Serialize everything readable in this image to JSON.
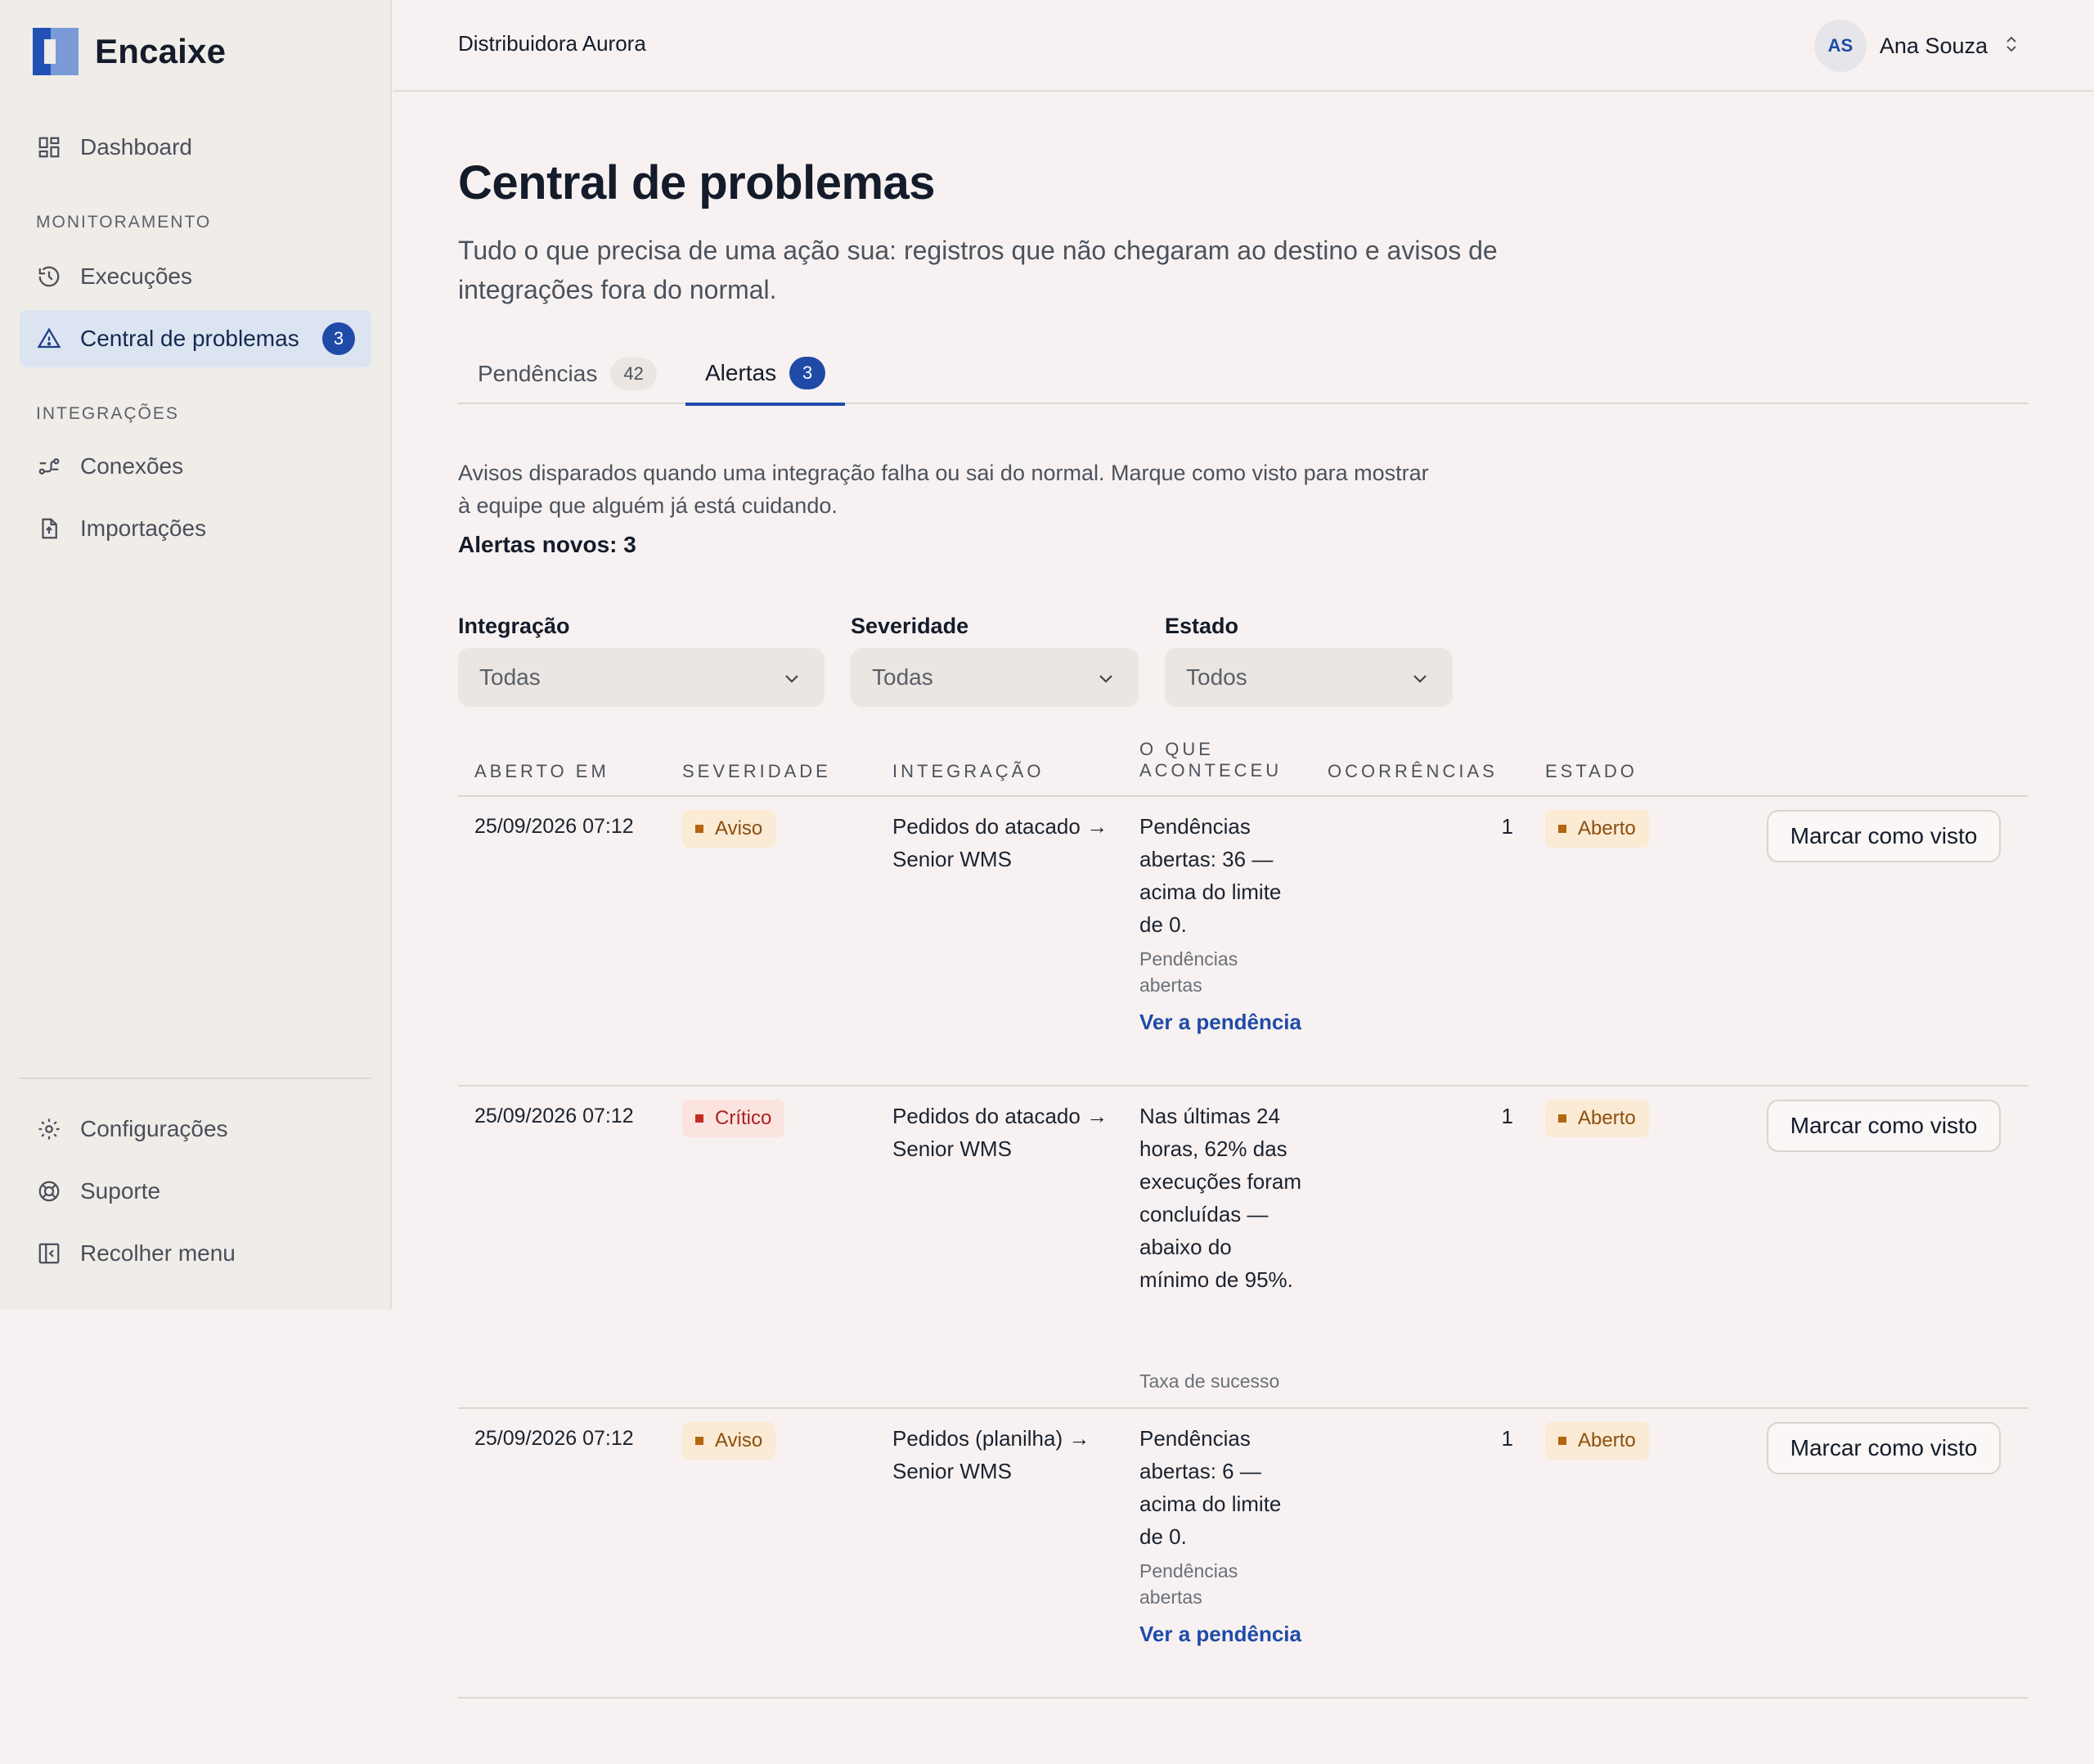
{
  "brand": {
    "name": "Encaixe"
  },
  "sidebar": {
    "items": [
      {
        "label": "Dashboard",
        "icon": "dashboard-icon"
      },
      {
        "label": "Execuções",
        "icon": "history-icon"
      },
      {
        "label": "Central de problemas",
        "icon": "warning-icon",
        "badge": "3",
        "active": true
      },
      {
        "label": "Conexões",
        "icon": "connections-icon"
      },
      {
        "label": "Importações",
        "icon": "file-import-icon"
      }
    ],
    "sections": {
      "monitoring": "MONITORAMENTO",
      "integrations": "INTEGRAÇÕES"
    },
    "footer": [
      {
        "label": "Configurações",
        "icon": "gear-icon"
      },
      {
        "label": "Suporte",
        "icon": "lifebuoy-icon"
      },
      {
        "label": "Recolher menu",
        "icon": "collapse-sidebar-icon"
      }
    ]
  },
  "topbar": {
    "org": "Distribuidora Aurora",
    "user": {
      "initials": "AS",
      "name": "Ana Souza"
    }
  },
  "page": {
    "title": "Central de problemas",
    "subtitle": "Tudo o que precisa de uma ação sua: registros que não chegaram ao destino e avisos de integrações fora do normal."
  },
  "tabs": [
    {
      "label": "Pendências",
      "count": "42"
    },
    {
      "label": "Alertas",
      "count": "3",
      "active": true
    }
  ],
  "alerts": {
    "intro": "Avisos disparados quando uma integração falha ou sai do normal. Marque como visto para mostrar à equipe que alguém já está cuidando.",
    "count_text": "Alertas novos: 3",
    "filters": [
      {
        "label": "Integração",
        "value": "Todas"
      },
      {
        "label": "Severidade",
        "value": "Todas"
      },
      {
        "label": "Estado",
        "value": "Todos"
      }
    ],
    "columns": [
      "ABERTO EM",
      "SEVERIDADE",
      "INTEGRAÇÃO",
      "O QUE ACONTECEU",
      "OCORRÊNCIAS",
      "ESTADO"
    ],
    "rows": [
      {
        "opened": "25/09/2026 07:12",
        "severity": "Aviso",
        "integration": "Pedidos do atacado → Senior WMS",
        "what": "Pendências abertas: 36 — acima do limite de 0.",
        "metric": "Pendências abertas",
        "link": "Ver a pendência",
        "occurrences": "1",
        "state": "Aberto",
        "action": "Marcar como visto"
      },
      {
        "opened": "25/09/2026 07:12",
        "severity": "Crítico",
        "integration": "Pedidos do atacado → Senior WMS",
        "what": "Nas últimas 24 horas, 62% das execuções foram concluídas — abaixo do mínimo de 95%.",
        "metric": "Taxa de sucesso",
        "occurrences": "1",
        "state": "Aberto",
        "action": "Marcar como visto"
      },
      {
        "opened": "25/09/2026 07:12",
        "severity": "Aviso",
        "integration": "Pedidos (planilha) → Senior WMS",
        "what": "Pendências abertas: 6 — acima do limite de 0.",
        "metric": "Pendências abertas",
        "link": "Ver a pendência",
        "occurrences": "1",
        "state": "Aberto",
        "action": "Marcar como visto"
      }
    ]
  },
  "colors": {
    "accent": "#1f4aa8",
    "warning": "#b3650f",
    "critical": "#c42b22",
    "background": "#f7f2f1",
    "sidebar": "#f0ece8"
  }
}
